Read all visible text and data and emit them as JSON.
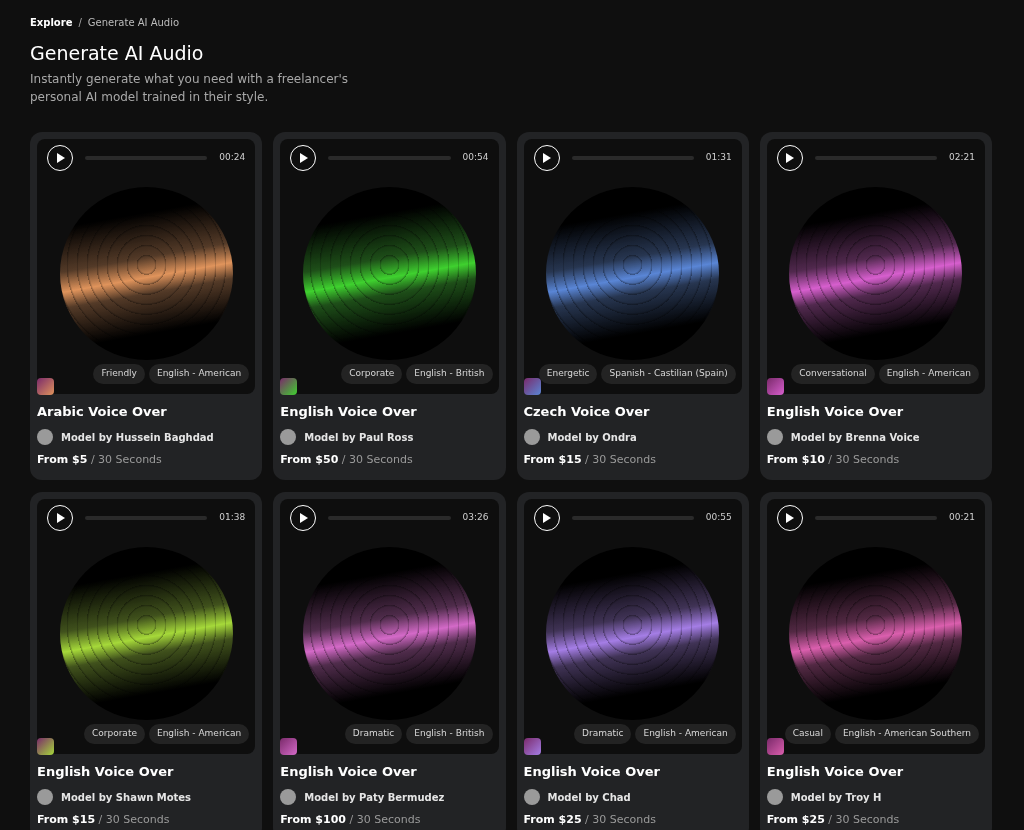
{
  "breadcrumb": [
    {
      "label": "Explore",
      "current": false
    },
    {
      "label": "Generate AI Audio",
      "current": true
    }
  ],
  "separator": "/",
  "title": "Generate AI Audio",
  "subtitle": "Instantly generate what you need with a freelancer's personal AI model trained in their style.",
  "cards": [
    {
      "duration": "00:24",
      "color": "#e0945c",
      "tags": [
        "Friendly",
        "English - American"
      ],
      "title": "Arabic Voice Over",
      "model": "Model by Hussein Baghdad",
      "price": "From $5",
      "unit": "/ 30 Seconds"
    },
    {
      "duration": "00:54",
      "color": "#3fd12f",
      "tags": [
        "Corporate",
        "English - British"
      ],
      "title": "English Voice Over",
      "model": "Model by Paul Ross",
      "price": "From $50",
      "unit": "/ 30 Seconds"
    },
    {
      "duration": "01:31",
      "color": "#5a86d6",
      "tags": [
        "Energetic",
        "Spanish - Castilian (Spain)"
      ],
      "title": "Czech Voice Over",
      "model": "Model by Ondra",
      "price": "From $15",
      "unit": "/ 30 Seconds"
    },
    {
      "duration": "02:21",
      "color": "#d75fce",
      "tags": [
        "Conversational",
        "English - American"
      ],
      "title": "English Voice Over",
      "model": "Model by Brenna Voice",
      "price": "From $10",
      "unit": "/ 30 Seconds"
    },
    {
      "duration": "01:38",
      "color": "#a6d93a",
      "tags": [
        "Corporate",
        "English - American"
      ],
      "title": "English Voice Over",
      "model": "Model by Shawn Motes",
      "price": "From $15",
      "unit": "/ 30 Seconds"
    },
    {
      "duration": "03:26",
      "color": "#d46ac8",
      "tags": [
        "Dramatic",
        "English - British"
      ],
      "title": "English Voice Over",
      "model": "Model by Paty Bermudez",
      "price": "From $100",
      "unit": "/ 30 Seconds"
    },
    {
      "duration": "00:55",
      "color": "#a57ee6",
      "tags": [
        "Dramatic",
        "English - American"
      ],
      "title": "English Voice Over",
      "model": "Model by Chad",
      "price": "From $25",
      "unit": "/ 30 Seconds"
    },
    {
      "duration": "00:21",
      "color": "#db5fae",
      "tags": [
        "Casual",
        "English - American Southern"
      ],
      "title": "English Voice Over",
      "model": "Model by Troy H",
      "price": "From $25",
      "unit": "/ 30 Seconds"
    }
  ]
}
